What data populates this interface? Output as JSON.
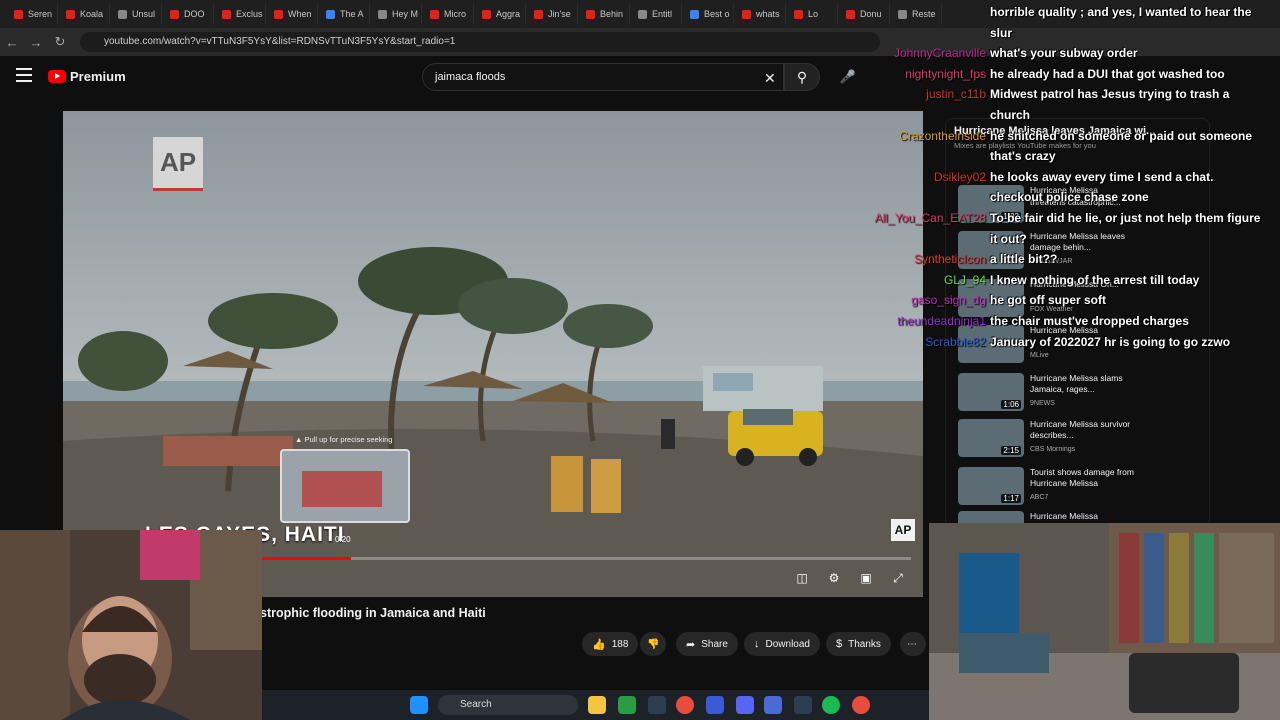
{
  "browser": {
    "tabs": [
      "Seren",
      "Koala",
      "Unsul",
      "DOO",
      "Exclus",
      "When",
      "The A",
      "Hey M",
      "Micro",
      "Aggra",
      "Jin'se",
      "Behin",
      "Entitl",
      "Best o",
      "whats",
      "Lo",
      "Donu",
      "Reste"
    ],
    "url": "youtube.com/watch?v=vTTuN3F5YsY&list=RDNSvTTuN3F5YsY&start_radio=1"
  },
  "youtube": {
    "logo_label": "Premium",
    "search_value": "jaimaca floods",
    "video": {
      "location_overlay": "LES CAYES, HAITI",
      "seek_hint": "Pull up for precise seeking",
      "seek_time": "0:20",
      "watermark": "AP",
      "progress_fraction": 0.33,
      "title": "strophic flooding in Jamaica and Haiti"
    },
    "actions": {
      "likes": "188",
      "share": "Share",
      "download": "Download",
      "thanks": "Thanks"
    },
    "sidebar": {
      "mix_title": "Hurricane Melissa leaves Jamaica wi...",
      "mix_subtitle": "Mixes are playlists YouTube makes for you",
      "items": [
        {
          "title": "Hurricane Melissa",
          "sub": "threatens catastrophic...",
          "channel": "",
          "duration": "1:02"
        },
        {
          "title": "Hurricane Melissa leaves damage behin...",
          "sub": "",
          "channel": "WPLG/WJAR",
          "duration": ""
        },
        {
          "title": "Hurricane Melissa On...",
          "sub": "",
          "channel": "FOX Weather",
          "duration": ""
        },
        {
          "title": "Hurricane Melissa",
          "sub": "",
          "channel": "MLive",
          "duration": ""
        },
        {
          "title": "Hurricane Melissa slams Jamaica, rages...",
          "sub": "",
          "channel": "9NEWS",
          "duration": "1:06"
        },
        {
          "title": "Hurricane Melissa survivor describes...",
          "sub": "",
          "channel": "CBS Mornings",
          "duration": "2:15"
        },
        {
          "title": "Tourist shows damage from Hurricane Melissa",
          "sub": "",
          "channel": "ABC7",
          "duration": "1:17"
        },
        {
          "title": "Hurricane Melissa",
          "sub": "",
          "channel": "",
          "duration": ""
        }
      ]
    }
  },
  "chat": [
    {
      "user": "",
      "text": "horrible quality ; and yes, I wanted to hear the",
      "color": "#ffffff"
    },
    {
      "user": "",
      "text": "slur",
      "color": "#ffffff"
    },
    {
      "user": "JohnnyCraanville",
      "text": "what's your subway order",
      "color": "#b9278f"
    },
    {
      "user": "nightynight_fps",
      "text": "he already had a DUI that got washed too",
      "color": "#d63b6b"
    },
    {
      "user": "justin_c11b",
      "text": "Midwest patrol has Jesus trying to trash a",
      "color": "#d62b2b"
    },
    {
      "user": "",
      "text": "church",
      "color": "#ffffff"
    },
    {
      "user": "Crazontheinside",
      "text": "he snitched on someone or paid out someone",
      "color": "#d99a2b"
    },
    {
      "user": "",
      "text": "that's crazy",
      "color": "#ffffff"
    },
    {
      "user": "Dsikley02",
      "text": "he looks away every time I send a chat.",
      "color": "#d62b2b"
    },
    {
      "user": "",
      "text": "checkout police chase zone",
      "color": "#ffffff"
    },
    {
      "user": "All_You_Can_EAT28",
      "text": "To be fair did he lie, or just not help them figure",
      "color": "#d63b6b"
    },
    {
      "user": "",
      "text": "it out?",
      "color": "#ffffff"
    },
    {
      "user": "SyntheticIcon",
      "text": "a little bit??",
      "color": "#e23b3b"
    },
    {
      "user": "GLJ_94",
      "text": "I knew nothing of the arrest till today",
      "color": "#6bd35b"
    },
    {
      "user": "gaso_sign_dg",
      "text": "he got off super soft",
      "color": "#c02bc0"
    },
    {
      "user": "theundeadninja1",
      "text": "the chair must've dropped charges",
      "color": "#9b2bd6"
    },
    {
      "user": "Scrabble82",
      "text": "January of 2022027 hr is going to go zzwo",
      "color": "#2b5bd6"
    }
  ],
  "taskbar": {
    "search_label": "Search"
  },
  "colors": {
    "accent": "#ff0000",
    "background": "#0f0f0f"
  }
}
